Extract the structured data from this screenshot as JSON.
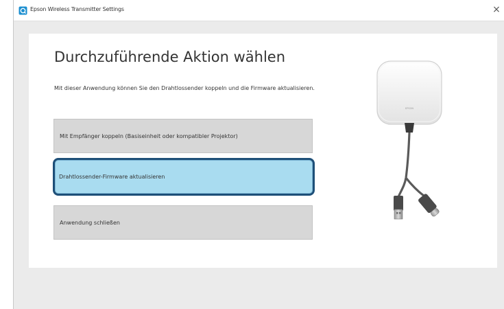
{
  "window": {
    "title": "Epson Wireless Transmitter Settings",
    "close_label": "×"
  },
  "main": {
    "heading": "Durchzuführende Aktion wählen",
    "description": "Mit dieser Anwendung können Sie den Drahtlossender koppeln und die Firmware aktualisieren.",
    "actions": [
      {
        "label": "Mit Empfänger koppeln (Basiseinheit oder kompatibler Projektor)"
      },
      {
        "label": "Drahtlossender-Firmware aktualisieren",
        "highlighted": true
      },
      {
        "label": "Anwendung schließen"
      }
    ]
  },
  "device": {
    "brand": "EPSON",
    "icon": "wireless-transmitter-illustration"
  },
  "colors": {
    "highlight_fill": "#a9dcf0",
    "highlight_border": "#1e4f78",
    "button_fill": "#d7d7d7",
    "window_bg": "#ebebeb"
  }
}
